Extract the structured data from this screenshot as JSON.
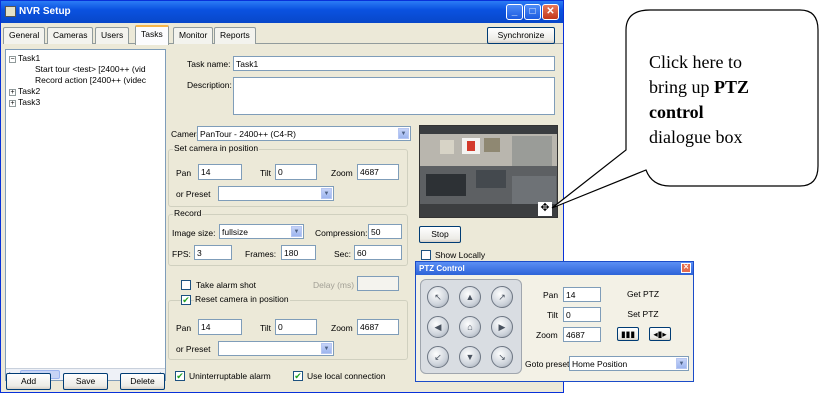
{
  "window": {
    "title": "NVR Setup"
  },
  "tabs": [
    "General",
    "Cameras",
    "Users",
    "Tasks",
    "Monitor",
    "Reports"
  ],
  "active_tab": "Tasks",
  "synchronize_label": "Synchronize",
  "tree": {
    "items": [
      {
        "label": "Task1",
        "expander": "−"
      },
      {
        "label": "Start tour <test> [2400++ (vid"
      },
      {
        "label": "Record action [2400++ (videc"
      },
      {
        "label": "Task2",
        "expander": "+"
      },
      {
        "label": "Task3",
        "expander": "+"
      }
    ]
  },
  "task": {
    "name_label": "Task name:",
    "name_value": "Task1",
    "description_label": "Description:"
  },
  "camera": {
    "label": "Camera",
    "value": "PanTour - 2400++ (C4-R)",
    "set_position_group": "Set camera in position",
    "pan_label": "Pan",
    "pan_value": "14",
    "tilt_label": "Tilt",
    "tilt_value": "0",
    "zoom_label": "Zoom",
    "zoom_value": "4687",
    "preset_label": "or Preset",
    "preset_value": ""
  },
  "record": {
    "group": "Record",
    "image_size_label": "Image size:",
    "image_size_value": "fullsize",
    "compression_label": "Compression:",
    "compression_value": "50",
    "fps_label": "FPS:",
    "fps_value": "3",
    "frames_label": "Frames:",
    "frames_value": "180",
    "sec_label": "Sec:",
    "sec_value": "60"
  },
  "alarm": {
    "take_alarm_shot": "Take alarm shot",
    "delay_label": "Delay (ms)",
    "reset_camera": "Reset camera in position",
    "pan_label": "Pan",
    "pan_value": "14",
    "tilt_label": "Tilt",
    "tilt_value": "0",
    "zoom_label": "Zoom",
    "zoom_value": "4687",
    "preset_label": "or Preset",
    "preset_value": ""
  },
  "footer": {
    "add": "Add",
    "save": "Save",
    "delete": "Delete",
    "uninterruptable": "Uninterruptable alarm",
    "use_local": "Use local connection"
  },
  "preview": {
    "stop": "Stop",
    "show_locally": "Show Locally"
  },
  "ptz": {
    "title": "PTZ Control",
    "pan_label": "Pan",
    "pan_value": "14",
    "tilt_label": "Tilt",
    "tilt_value": "0",
    "zoom_label": "Zoom",
    "zoom_value": "4687",
    "get_ptz": "Get PTZ",
    "set_ptz": "Set PTZ",
    "goto_preset_label": "Goto preset",
    "goto_preset_value": "Home Position"
  },
  "callout": {
    "line1": "Click here to",
    "line2a": "bring up ",
    "line2b": "PTZ",
    "line3": "control",
    "line4": "dialogue box"
  },
  "colors": {
    "titlebar": "#0a52e0",
    "window_bg": "#ece9d8",
    "checkmark": "#21a121"
  }
}
